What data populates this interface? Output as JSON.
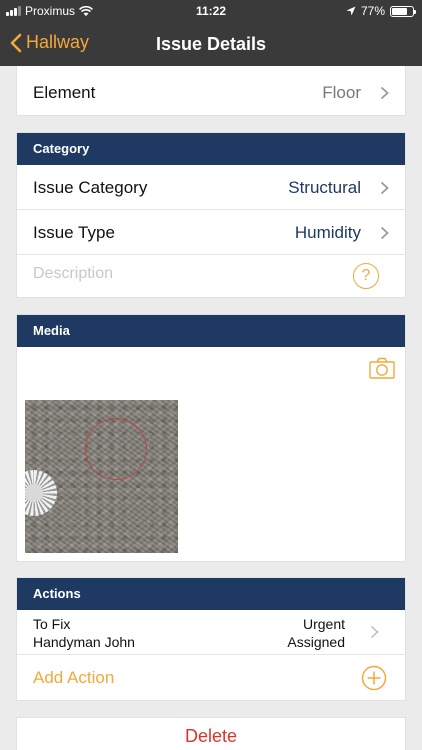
{
  "status_bar": {
    "carrier": "Proximus",
    "time": "11:22",
    "battery": "77%",
    "battery_level": 0.77
  },
  "nav": {
    "back_label": "Hallway",
    "title": "Issue Details"
  },
  "element_row": {
    "label": "Element",
    "value": "Floor"
  },
  "category": {
    "header": "Category",
    "issue_category": {
      "label": "Issue Category",
      "value": "Structural"
    },
    "issue_type": {
      "label": "Issue Type",
      "value": "Humidity"
    },
    "description_placeholder": "Description"
  },
  "media": {
    "header": "Media"
  },
  "actions": {
    "header": "Actions",
    "items": [
      {
        "title": "To Fix",
        "assignee": "Handyman John",
        "priority": "Urgent",
        "status": "Assigned"
      }
    ],
    "add_label": "Add Action"
  },
  "delete_label": "Delete",
  "colors": {
    "accent": "#f2a93b",
    "header_navy": "#1e3a63",
    "danger": "#e0312d",
    "bar": "#3a3a3a"
  }
}
